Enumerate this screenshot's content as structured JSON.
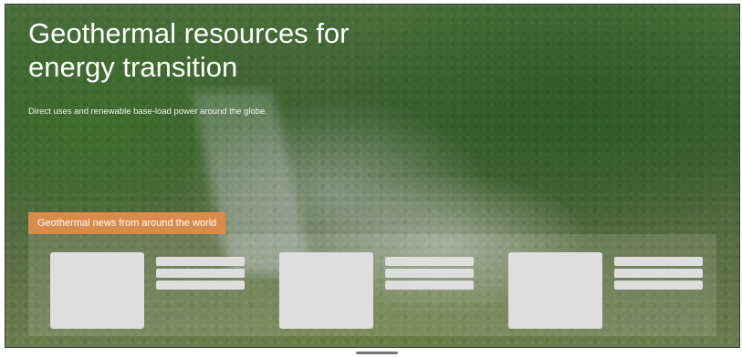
{
  "hero": {
    "title": "Geothermal resources for energy transition",
    "subtitle": "Direct uses and renewable base-load power around the globe."
  },
  "news": {
    "section_label": "Geothermal news from around the world",
    "cards": [
      {
        "placeholder_lines": 3
      },
      {
        "placeholder_lines": 3
      },
      {
        "placeholder_lines": 3
      }
    ]
  },
  "colors": {
    "accent": "#d98c4a",
    "placeholder": "#dedede"
  }
}
